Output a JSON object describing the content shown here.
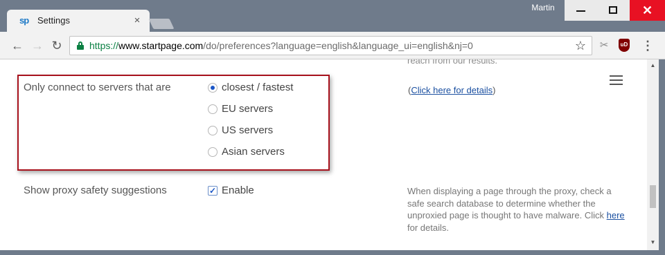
{
  "browser": {
    "tab": {
      "favicon_text": "sp",
      "title": "Settings",
      "close_glyph": "×"
    },
    "user_name": "Martin",
    "window_controls": {
      "close_glyph": "✕"
    },
    "toolbar": {
      "back_glyph": "←",
      "forward_glyph": "→",
      "reload_glyph": "↻",
      "url_scheme": "https://",
      "url_host": "www.startpage.com",
      "url_path": "/do/preferences?language=english&language_ui=english&nj=0",
      "star_glyph": "☆",
      "scissors_glyph": "✂",
      "ublock_text": "uD",
      "menu_glyph": "⋮"
    }
  },
  "page": {
    "cutoff_text": "reach from our results.",
    "server_setting": {
      "label": "Only connect to servers that are",
      "options": [
        {
          "label": "closest / fastest",
          "checked": true
        },
        {
          "label": "EU servers",
          "checked": false
        },
        {
          "label": "US servers",
          "checked": false
        },
        {
          "label": "Asian servers",
          "checked": false
        }
      ],
      "details_prefix": "(",
      "details_link": "Click here for details",
      "details_suffix": ")"
    },
    "proxy_setting": {
      "label": "Show proxy safety suggestions",
      "checkbox_label": "Enable",
      "checked": true,
      "description_text": "When displaying a page through the proxy, check a safe search database to determine whether the unproxied page is thought to have malware. Click",
      "description_link": "here",
      "description_suffix": "for details."
    }
  },
  "colors": {
    "highlight_border": "#a7111c",
    "link": "#1a4fa0",
    "secure_green": "#0b8043",
    "close_red": "#e81123"
  },
  "icons": [
    "back-icon",
    "forward-icon",
    "reload-icon",
    "lock-icon",
    "star-icon",
    "scissors-icon",
    "ublock-icon",
    "menu-icon",
    "hamburger-icon"
  ]
}
